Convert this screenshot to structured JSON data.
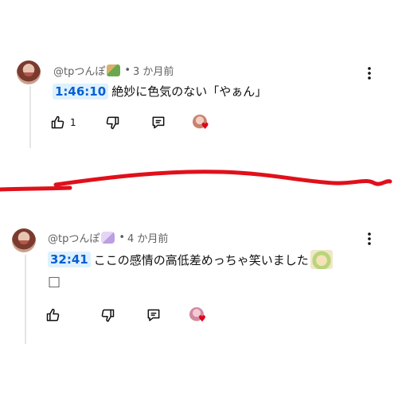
{
  "comments": [
    {
      "author": "@tpつんぽ",
      "separator": "•",
      "age": "3 か月前",
      "timestamp": "1:46:10",
      "text": "絶妙に色気のない「やぁん」",
      "like_count": "1"
    },
    {
      "author": "@tpつんぽ",
      "separator": "•",
      "age": "4 か月前",
      "timestamp": "32:41",
      "text": "ここの感情の高低差めっちゃ笑いました",
      "trailing_box": "□"
    }
  ],
  "icons": {
    "like": "thumbs-up-icon",
    "dislike": "thumbs-down-icon",
    "reply": "reply-icon",
    "more": "more-vertical-icon",
    "creator_heart": "creator-heart-icon"
  },
  "colors": {
    "timestamp_link": "#065fd4",
    "timestamp_bg": "#def1ff",
    "heart": "#e0001b",
    "scribble": "#e0101b"
  }
}
